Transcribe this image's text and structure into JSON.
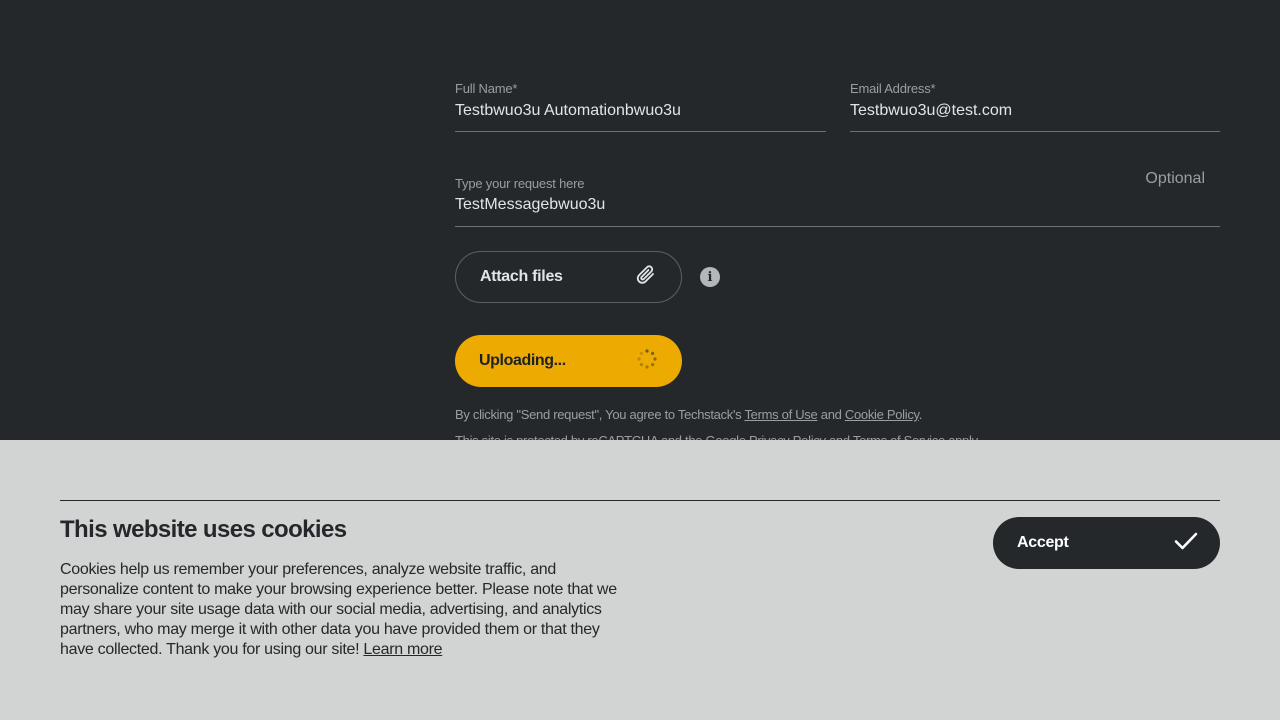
{
  "form": {
    "full_name": {
      "label": "Full Name*",
      "value": "Testbwuo3u Automationbwuo3u"
    },
    "email": {
      "label": "Email Address*",
      "value": "Testbwuo3u@test.com"
    },
    "message": {
      "label": "Type your request here",
      "value": "TestMessagebwuo3u",
      "optional_label": "Optional"
    },
    "attach_label": "Attach files",
    "attach_icon": "paperclip-icon",
    "info_icon": "info-icon",
    "info_glyph": "i",
    "submit_label": "Uploading...",
    "submit_icon": "spinner-icon",
    "accent_color": "#edaa00"
  },
  "legal": {
    "line1_prefix": "By clicking \"Send request\", You agree to Techstack's ",
    "terms_link": "Terms of Use",
    "and": " and ",
    "cookie_link": "Cookie Policy",
    "period": ".",
    "line2_prefix": "This site is protected by reCAPTCHA and the Google ",
    "privacy_link": "Privacy Policy",
    "and2": " and ",
    "tos_link": "Terms of Service",
    "line2_suffix": " apply."
  },
  "cookie_banner": {
    "title": "This website uses cookies",
    "text": "Cookies help us remember your preferences, analyze website traffic, and personalize content to make your browsing experience better. Please note that we may share your site usage data with our social media, advertising, and analytics partners, who may merge it with other data you have provided them or that they have collected. Thank you for using our site! ",
    "learn_more": "Learn more",
    "accept_label": "Accept",
    "accept_icon": "checkmark-icon"
  }
}
